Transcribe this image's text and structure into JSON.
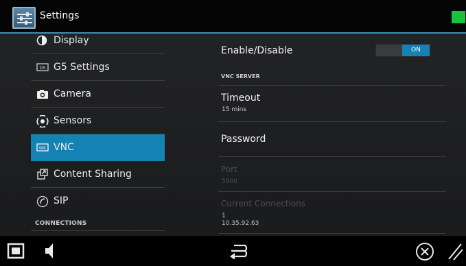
{
  "app": {
    "title": "Settings",
    "icon": "settings-sliders-icon",
    "status_color": "#19c43a"
  },
  "menu": {
    "items": [
      {
        "label": "Display",
        "icon": "display-icon"
      },
      {
        "label": "G5 Settings",
        "icon": "g5-icon"
      },
      {
        "label": "Camera",
        "icon": "camera-icon"
      },
      {
        "label": "Sensors",
        "icon": "sensors-icon"
      },
      {
        "label": "VNC",
        "icon": "vnc-icon",
        "active": true
      },
      {
        "label": "Content Sharing",
        "icon": "content-sharing-icon"
      },
      {
        "label": "SIP",
        "icon": "sip-icon"
      }
    ],
    "section_connections": "CONNECTIONS"
  },
  "vnc": {
    "enable_label": "Enable/Disable",
    "toggle_state": "ON",
    "section_server": "VNC SERVER",
    "timeout_label": "Timeout",
    "timeout_value": "15 mins",
    "password_label": "Password",
    "port_label": "Port",
    "port_value": "5900",
    "connections_label": "Current Connections",
    "connections_count": "1",
    "connections_ip": "10.35.92.63"
  },
  "navbar": {
    "icons": [
      "recent-apps-icon",
      "volume-icon",
      "back-icon",
      "close-circle-icon",
      "resize-handle-icon"
    ]
  },
  "colors": {
    "accent": "#1582b4",
    "title_underline": "#3b8fb3"
  }
}
